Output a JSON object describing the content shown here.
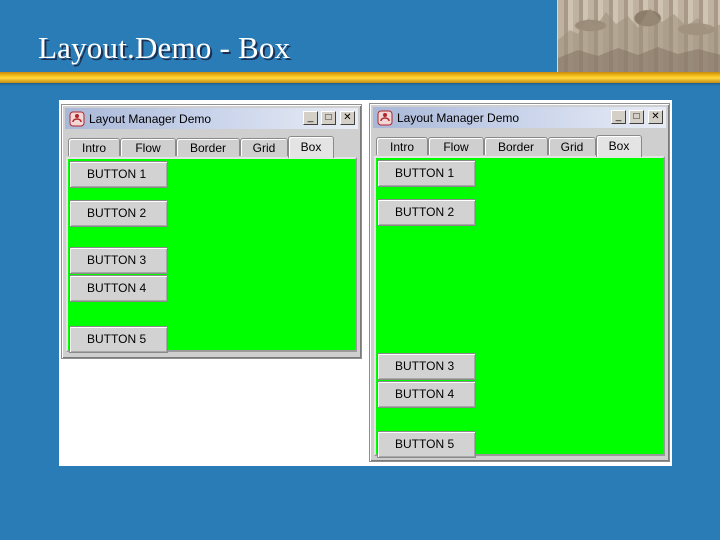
{
  "slide": {
    "title": "Layout.Demo - Box"
  },
  "windows": [
    {
      "title": "Layout Manager Demo",
      "controls": {
        "minimize": "_",
        "maximize": "□",
        "close": "✕"
      },
      "tabs": [
        "Intro",
        "Flow",
        "Border",
        "Grid",
        "Box"
      ],
      "active_tab": "Box",
      "buttons": [
        "BUTTON 1",
        "BUTTON 2",
        "BUTTON 3",
        "BUTTON 4",
        "BUTTON 5"
      ]
    },
    {
      "title": "Layout Manager Demo",
      "controls": {
        "minimize": "_",
        "maximize": "□",
        "close": "✕"
      },
      "tabs": [
        "Intro",
        "Flow",
        "Border",
        "Grid",
        "Box"
      ],
      "active_tab": "Box",
      "buttons": [
        "BUTTON 1",
        "BUTTON 2",
        "BUTTON 3",
        "BUTTON 4",
        "BUTTON 5"
      ]
    }
  ],
  "colors": {
    "slide_background": "#2a7cb6",
    "accent_stripe": "#f6c21b",
    "pane_background": "#00ff00"
  },
  "icons": [
    "java-app-icon",
    "minimize-icon",
    "maximize-icon",
    "close-icon"
  ]
}
